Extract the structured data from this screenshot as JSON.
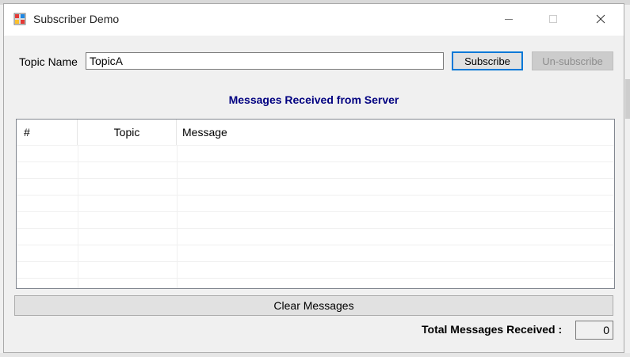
{
  "window": {
    "title": "Subscriber Demo"
  },
  "topic": {
    "label": "Topic Name",
    "value": "TopicA"
  },
  "buttons": {
    "subscribe": "Subscribe",
    "unsubscribe": "Un-subscribe",
    "clear": "Clear Messages"
  },
  "messages": {
    "title": "Messages Received  from Server",
    "columns": [
      "#",
      "Topic",
      "Message"
    ],
    "rows": []
  },
  "total": {
    "label": "Total Messages Received :",
    "value": "0"
  },
  "colors": {
    "title_text": "#000080",
    "focus_border": "#0078d7"
  },
  "icons": {
    "app": "windows-forms-app-icon",
    "minimize": "minimize-icon",
    "maximize": "maximize-icon",
    "close": "close-icon"
  }
}
